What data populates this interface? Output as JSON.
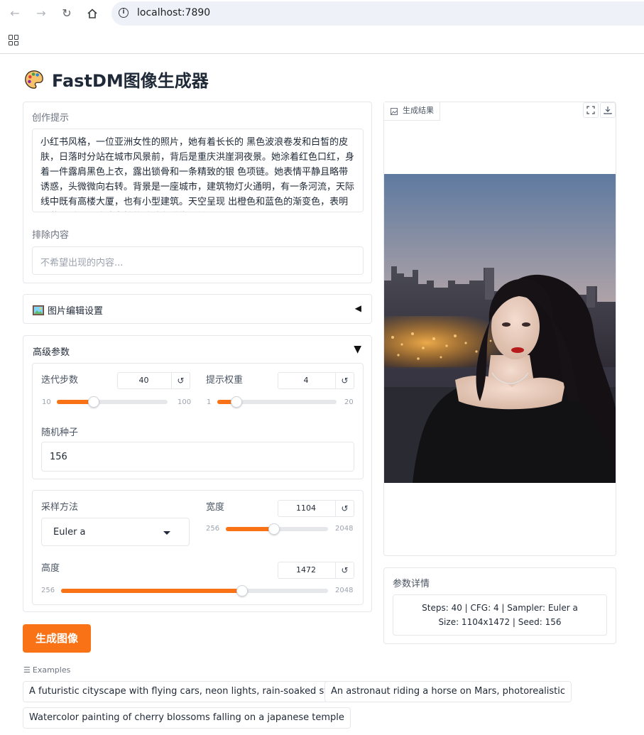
{
  "browser": {
    "url": "localhost:7890"
  },
  "app": {
    "title": "FastDM图像生成器",
    "title_icon": "palette-icon"
  },
  "prompt": {
    "label": "创作提示",
    "value": "小红书风格，一位亚洲女性的照片，她有着长长的 黑色波浪卷发和白皙的皮肤，日落时分站在城市风景前，背后是重庆洪崖洞夜景。她涂着红色口红，身着一件露肩黑色上衣，露出锁骨和一条精致的银 色项链。她表情平静且略带诱惑，头微微向右转。背景是一座城市，建筑物灯火通明，有一条河流，天际线中既有高楼大厦，也有小型建筑。天空呈现 出橙色和蓝色的渐变色，表明是黄昏时分。这位女性的脸稍有模糊，给画"
  },
  "negative": {
    "label": "排除内容",
    "placeholder": "不希望出现的内容..."
  },
  "image_edit": {
    "label": "图片编辑设置",
    "icon": "picture-icon",
    "collapsed_indicator": "◀"
  },
  "advanced": {
    "label": "高级参数",
    "expanded_indicator": "▼",
    "steps": {
      "label": "迭代步数",
      "value": "40",
      "min": "10",
      "max": "100",
      "fraction": 0.333
    },
    "cfg": {
      "label": "提示权重",
      "value": "4",
      "min": "1",
      "max": "20",
      "fraction": 0.158
    },
    "seed": {
      "label": "随机种子",
      "value": "156"
    },
    "sampler": {
      "label": "采样方法",
      "value": "Euler a"
    },
    "width": {
      "label": "宽度",
      "value": "1104",
      "min": "256",
      "max": "2048",
      "fraction": 0.473
    },
    "height": {
      "label": "高度",
      "value": "1472",
      "min": "256",
      "max": "2048",
      "fraction": 0.679
    },
    "reset_symbol": "↺"
  },
  "generate_button": {
    "label": "生成图像"
  },
  "output": {
    "tab_label": "生成结果",
    "fullscreen_icon": "fullscreen-icon",
    "download_icon": "download-icon"
  },
  "details": {
    "label": "参数详情",
    "line1": "Steps: 40 | CFG: 4 | Sampler: Euler a",
    "line2": "Size: 1104x1472 | Seed: 156"
  },
  "examples": {
    "label": "Examples",
    "items": [
      "A futuristic cityscape with flying cars, neon lights, rain-soaked streets",
      "An astronaut riding a horse on Mars, photorealistic",
      "Watercolor painting of cherry blossoms falling on a japanese temple"
    ]
  },
  "colors": {
    "accent": "#f97316",
    "border": "#e5e7eb"
  }
}
